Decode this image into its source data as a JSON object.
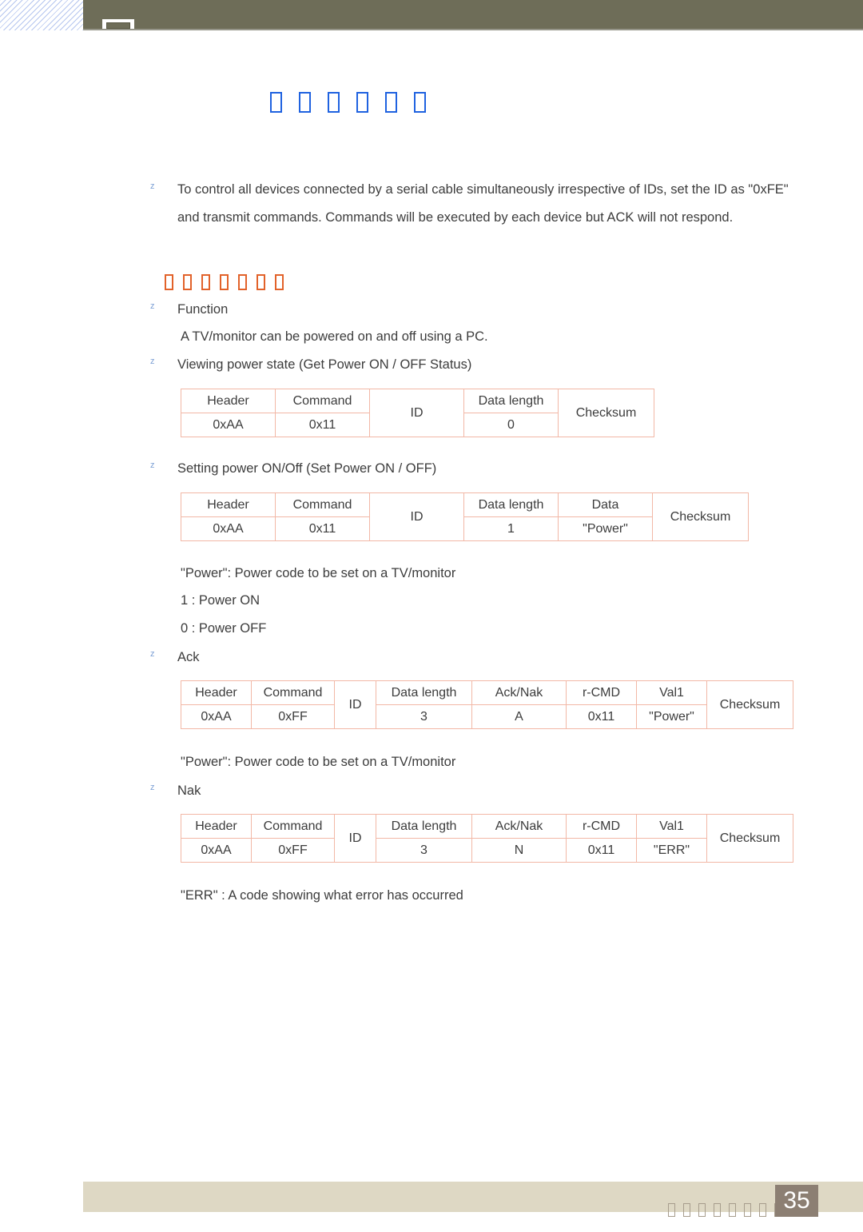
{
  "header": {
    "chapter_tab_icon": "chapter-marker",
    "bar_color": "#6e6d58",
    "hatch_color": "#7896e1"
  },
  "page_title": {
    "glyph_count": 6,
    "color": "#1f62e0",
    "note": "missing-glyph boxes (tofu)"
  },
  "intro": {
    "bullet_marker": "z",
    "text": "To control all devices connected by a serial cable simultaneously irrespective of IDs, set the ID as \"0xFE\" and transmit commands. Commands will be executed by each device but ACK will not respond."
  },
  "section_heading": {
    "glyph_count": 7,
    "color": "#e2622a",
    "note": "missing-glyph boxes (tofu)"
  },
  "items": {
    "function_label": "Function",
    "function_desc": "A TV/monitor can be powered on and off using a PC.",
    "view_power_state": "Viewing power state (Get Power ON / OFF Status)",
    "set_power": "Setting power ON/Off (Set Power ON / OFF)",
    "power_note": "\"Power\": Power code to be set on a TV/monitor",
    "power_on": "1 : Power ON",
    "power_off": "0 : Power OFF",
    "ack_label": "Ack",
    "ack_power_note": "\"Power\": Power code to be set on a TV/monitor",
    "nak_label": "Nak",
    "err_note": "\"ERR\" : A code showing what error has occurred"
  },
  "tables": {
    "get_power_status": {
      "headers": [
        "Header",
        "Command",
        "ID",
        "Data length",
        "Checksum"
      ],
      "values": [
        "0xAA",
        "0x11",
        "",
        "0",
        ""
      ]
    },
    "set_power": {
      "headers": [
        "Header",
        "Command",
        "ID",
        "Data length",
        "Data",
        "Checksum"
      ],
      "values": [
        "0xAA",
        "0x11",
        "",
        "1",
        "\"Power\"",
        ""
      ]
    },
    "ack": {
      "headers": [
        "Header",
        "Command",
        "ID",
        "Data length",
        "Ack/Nak",
        "r-CMD",
        "Val1",
        "Checksum"
      ],
      "values": [
        "0xAA",
        "0xFF",
        "",
        "3",
        "A",
        "0x11",
        "\"Power\"",
        ""
      ]
    },
    "nak": {
      "headers": [
        "Header",
        "Command",
        "ID",
        "Data length",
        "Ack/Nak",
        "r-CMD",
        "Val1",
        "Checksum"
      ],
      "values": [
        "0xAA",
        "0xFF",
        "",
        "3",
        "N",
        "0x11",
        "\"ERR\"",
        ""
      ]
    }
  },
  "footer": {
    "glyph_count": 8,
    "page_number": "35",
    "bar_color": "#ded8c4",
    "page_box_color": "#8c7f73"
  }
}
